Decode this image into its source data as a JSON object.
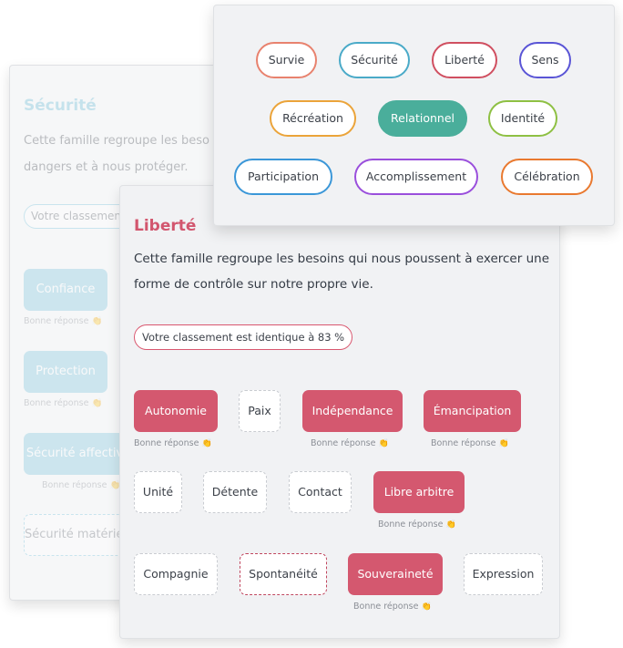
{
  "back_card": {
    "title": "Sécurité",
    "description": "Cette famille regroupe les besoins qui nous poussent à éviter les dangers et à nous protéger.",
    "description_line1": "Cette famille regroupe les beso",
    "description_line2": "dangers et à nous protéger.",
    "ranking_text": "Votre classement",
    "accent_color": "#6dbcd6",
    "chips": [
      {
        "label": "Confiance",
        "state": "correct",
        "note": "Bonne réponse 👏"
      },
      {
        "label": "Protection",
        "state": "correct",
        "note": "Bonne réponse 👏"
      },
      {
        "label": "Sécurité affective",
        "state": "correct",
        "note": "Bonne réponse 👏"
      },
      {
        "label": "Sécurité matérielle",
        "state": "empty"
      }
    ]
  },
  "main_card": {
    "title": "Liberté",
    "description": "Cette famille regroupe les besoins qui nous poussent à exercer une forme de contrôle sur notre propre vie.",
    "ranking_text": "Votre classement est identique à 83 %",
    "match_percent": 83,
    "accent_color": "#d4586f",
    "note_text": "Bonne réponse",
    "note_icon": "👏",
    "chips": [
      {
        "label": "Autonomie",
        "state": "correct"
      },
      {
        "label": "Paix",
        "state": "empty"
      },
      {
        "label": "Indépendance",
        "state": "correct"
      },
      {
        "label": "Émancipation",
        "state": "correct"
      },
      {
        "label": "Unité",
        "state": "empty"
      },
      {
        "label": "Détente",
        "state": "empty"
      },
      {
        "label": "Contact",
        "state": "empty"
      },
      {
        "label": "Libre arbitre",
        "state": "correct"
      },
      {
        "label": "Compagnie",
        "state": "empty"
      },
      {
        "label": "Spontanéité",
        "state": "missed"
      },
      {
        "label": "Souveraineté",
        "state": "correct"
      },
      {
        "label": "Expression",
        "state": "empty"
      }
    ]
  },
  "categories": [
    {
      "label": "Survie",
      "color": "#e8826e"
    },
    {
      "label": "Sécurité",
      "color": "#4aaac8"
    },
    {
      "label": "Liberté",
      "color": "#d04f60"
    },
    {
      "label": "Sens",
      "color": "#5a55d6"
    },
    {
      "label": "Récréation",
      "color": "#eba43a"
    },
    {
      "label": "Relationnel",
      "color": "#4aae9b",
      "active": true
    },
    {
      "label": "Identité",
      "color": "#8ec043"
    },
    {
      "label": "Participation",
      "color": "#3b97d8"
    },
    {
      "label": "Accomplissement",
      "color": "#9a4fdc"
    },
    {
      "label": "Célébration",
      "color": "#e9792f"
    }
  ]
}
